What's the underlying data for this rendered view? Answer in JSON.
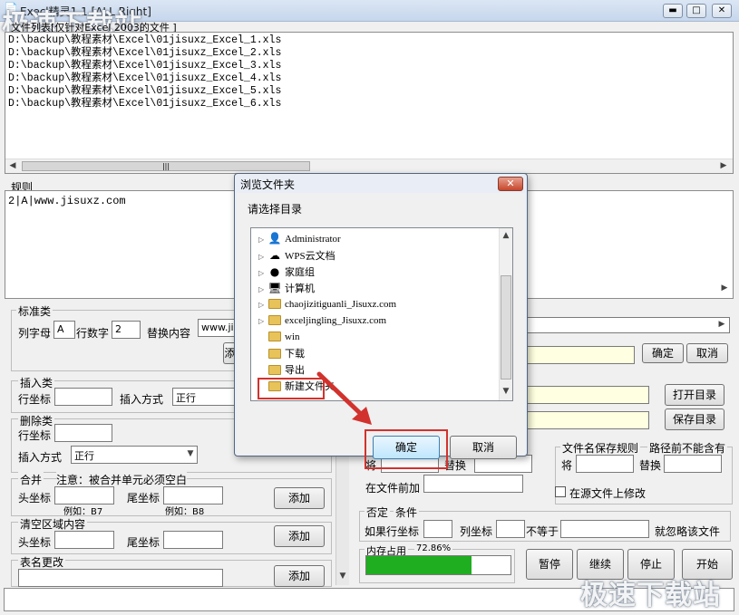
{
  "window": {
    "title": "Execl精灵1.1 [ALL Right]",
    "minimize": "▬",
    "maximize": "□",
    "close": "✕"
  },
  "watermark": {
    "top": "极速下载站",
    "bottom": "极速下载站"
  },
  "file_list": {
    "legend": "文件列表[仅针对Excel 2003的文件 ]",
    "files": [
      "D:\\backup\\教程素材\\Excel\\01jisuxz_Excel_1.xls",
      "D:\\backup\\教程素材\\Excel\\01jisuxz_Excel_2.xls",
      "D:\\backup\\教程素材\\Excel\\01jisuxz_Excel_3.xls",
      "D:\\backup\\教程素材\\Excel\\01jisuxz_Excel_4.xls",
      "D:\\backup\\教程素材\\Excel\\01jisuxz_Excel_5.xls",
      "D:\\backup\\教程素材\\Excel\\01jisuxz_Excel_6.xls"
    ],
    "scroll_grip": "|||"
  },
  "rules": {
    "legend": "规则",
    "line": "2|A|www.jisuxz.com"
  },
  "standard": {
    "legend": "标准类",
    "col_letter_label": "列字母",
    "col_letter_value": "A",
    "row_num_label": "行数字",
    "row_num_value": "2",
    "replace_label": "替换内容",
    "replace_value": "www.ji",
    "add_btn_partial": "添"
  },
  "insert": {
    "legend": "插入类",
    "row_label": "行坐标",
    "mode_label": "插入方式",
    "mode_value": "正行"
  },
  "delete": {
    "legend": "删除类",
    "row_label": "行坐标",
    "mode_label": "插入方式",
    "mode_value": "正行"
  },
  "merge": {
    "legend": "合并",
    "note": "注意：被合并单元必须空白",
    "head_label": "头坐标",
    "tail_label": "尾坐标",
    "head_example": "例如：B7",
    "tail_example": "例如：B8",
    "add": "添加"
  },
  "clear": {
    "legend": "清空区域内容",
    "head_label": "头坐标",
    "tail_label": "尾坐标",
    "add": "添加"
  },
  "rename": {
    "legend": "表名更改",
    "add": "添加"
  },
  "right": {
    "confirm": "确定",
    "cancel": "取消",
    "open_dir": "打开目录",
    "save_dir": "保存目录",
    "replace_to": "将",
    "replace_with": "替换",
    "prepend_label": "在文件前加",
    "save_rule_legend": "文件名保存规则",
    "path_note": "路径前不能含有",
    "save_to": "将",
    "save_with": "替换",
    "modify_source": "在源文件上修改",
    "negate_legend": "否定",
    "condition_legend": "条件",
    "if_row": "如果行坐标",
    "col": "列坐标",
    "not_equal": "不等于",
    "ignore": "就忽略该文件",
    "memory_legend": "内存占用",
    "memory_value": "72.86%",
    "memory_fraction": 0.7286,
    "pause": "暂停",
    "resume": "继续",
    "stop": "停止",
    "start": "开始"
  },
  "dialog": {
    "title": "浏览文件夹",
    "close": "✕",
    "prompt": "请选择目录",
    "items": [
      {
        "label": "Administrator",
        "icon": "user-folder-icon",
        "expand": "▷"
      },
      {
        "label": "WPS云文档",
        "icon": "cloud-icon",
        "expand": "▷"
      },
      {
        "label": "家庭组",
        "icon": "homegroup-icon",
        "expand": "▷"
      },
      {
        "label": "计算机",
        "icon": "computer-icon",
        "expand": "▷"
      },
      {
        "label": "chaojizitiguanli_Jisuxz.com",
        "icon": "folder-icon",
        "expand": "▷"
      },
      {
        "label": "exceljingling_Jisuxz.com",
        "icon": "folder-icon",
        "expand": "▷"
      },
      {
        "label": "win",
        "icon": "folder-icon",
        "expand": ""
      },
      {
        "label": "下载",
        "icon": "folder-icon",
        "expand": ""
      },
      {
        "label": "导出",
        "icon": "folder-icon",
        "expand": "",
        "selected": true
      },
      {
        "label": "新建文件夹",
        "icon": "folder-icon",
        "expand": ""
      }
    ],
    "ok": "确定",
    "cancel": "取消"
  },
  "colors": {
    "annotation": "#d2322d",
    "progress": "#1fae1f"
  }
}
